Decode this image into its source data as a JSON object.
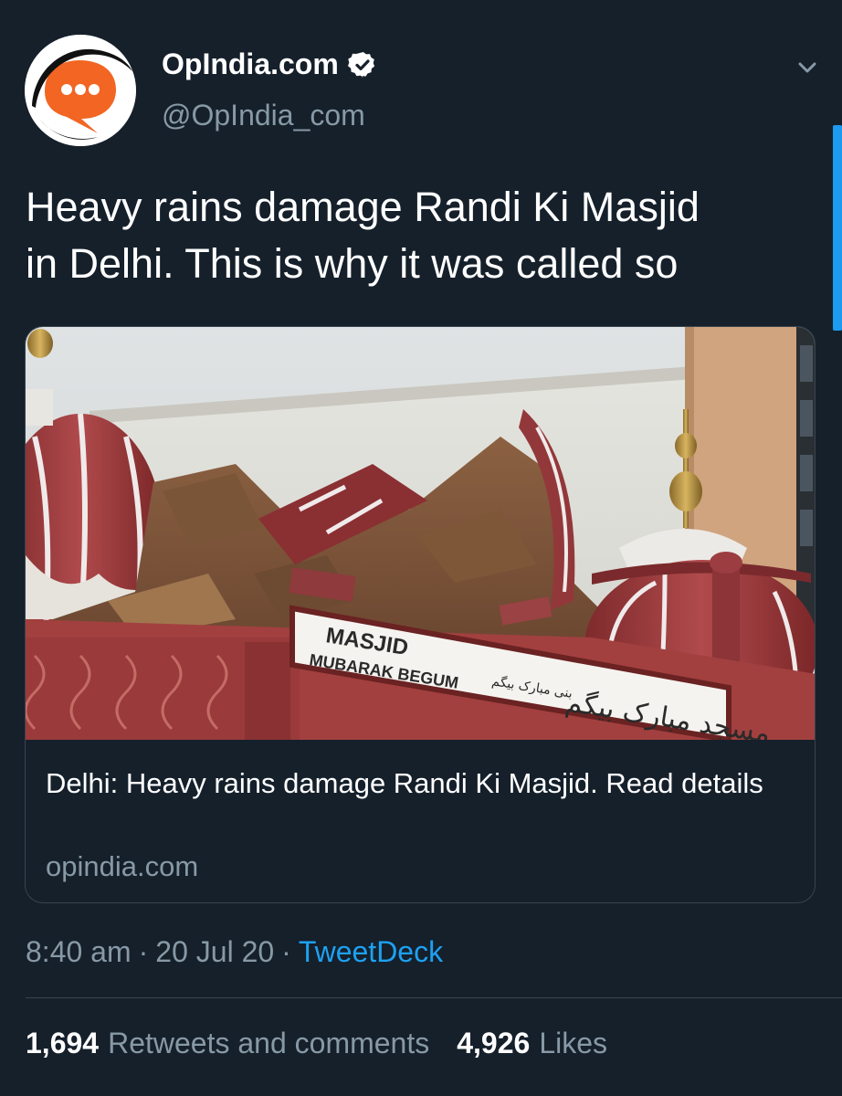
{
  "account": {
    "display_name": "OpIndia.com",
    "handle": "@OpIndia_com",
    "verified": true,
    "avatar_icon": "speech-bubble-logo",
    "brand_color": "#f26522"
  },
  "tweet": {
    "text": "Heavy rains damage Randi Ki Masjid\nin Delhi. This is why it was called so"
  },
  "card": {
    "title": "Delhi: Heavy rains damage Randi Ki Masjid. Read details",
    "domain": "opindia.com",
    "image_sign": {
      "line1": "MASJID",
      "line2": "MUBARAK BEGUM",
      "urdu_small": "بنی مبارک بیگم",
      "urdu_large": "مسجد مبارک بیگم"
    }
  },
  "meta": {
    "time": "8:40 am",
    "separator": "·",
    "date": "20 Jul 20",
    "source": "TweetDeck"
  },
  "stats": {
    "retweets_count": "1,694",
    "retweets_label": "Retweets and comments",
    "likes_count": "4,926",
    "likes_label": "Likes"
  },
  "colors": {
    "background": "#15202b",
    "text_secondary": "#8899a6",
    "link": "#1da1f2",
    "border": "#38444d"
  }
}
